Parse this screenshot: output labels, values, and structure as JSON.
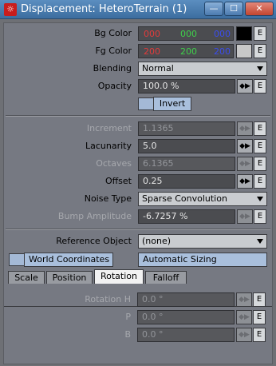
{
  "window": {
    "title": "Displacement: HeteroTerrain (1)",
    "app_icon_glyph": "☼",
    "controls": {
      "minimize": "—",
      "maximize": "☐",
      "close": "✕"
    }
  },
  "bg_color": {
    "label": "Bg Color",
    "r": "000",
    "g": "000",
    "b": "000",
    "swatch": "#000000"
  },
  "fg_color": {
    "label": "Fg Color",
    "r": "200",
    "g": "200",
    "b": "200",
    "swatch": "#c8c8c8"
  },
  "blending": {
    "label": "Blending",
    "value": "Normal"
  },
  "opacity": {
    "label": "Opacity",
    "value": "100.0 %"
  },
  "invert": {
    "label": "Invert"
  },
  "params": {
    "increment": {
      "label": "Increment",
      "value": "1.1365"
    },
    "lacunarity": {
      "label": "Lacunarity",
      "value": "5.0"
    },
    "octaves": {
      "label": "Octaves",
      "value": "6.1365"
    },
    "offset": {
      "label": "Offset",
      "value": "0.25"
    },
    "noise_type": {
      "label": "Noise Type",
      "value": "Sparse Convolution"
    },
    "bump_amplitude": {
      "label": "Bump Amplitude",
      "value": "-6.7257 %"
    }
  },
  "reference_object": {
    "label": "Reference Object",
    "value": "(none)"
  },
  "world_coordinates": {
    "label": "World Coordinates"
  },
  "automatic_sizing": {
    "label": "Automatic Sizing"
  },
  "tabs": [
    {
      "label": "Scale"
    },
    {
      "label": "Position"
    },
    {
      "label": "Rotation"
    },
    {
      "label": "Falloff"
    }
  ],
  "active_tab": "Rotation",
  "rotation": {
    "h": {
      "label": "Rotation H",
      "value": "0.0 °"
    },
    "p": {
      "label": "P",
      "value": "0.0 °"
    },
    "b": {
      "label": "B",
      "value": "0.0 °"
    }
  },
  "common": {
    "e_label": "E",
    "drag_glyph": "◆▶"
  },
  "colors": {
    "red": "#e23b3b",
    "green": "#3fd04a",
    "blue": "#3b4cf0",
    "accent": "#a9bfdc"
  }
}
